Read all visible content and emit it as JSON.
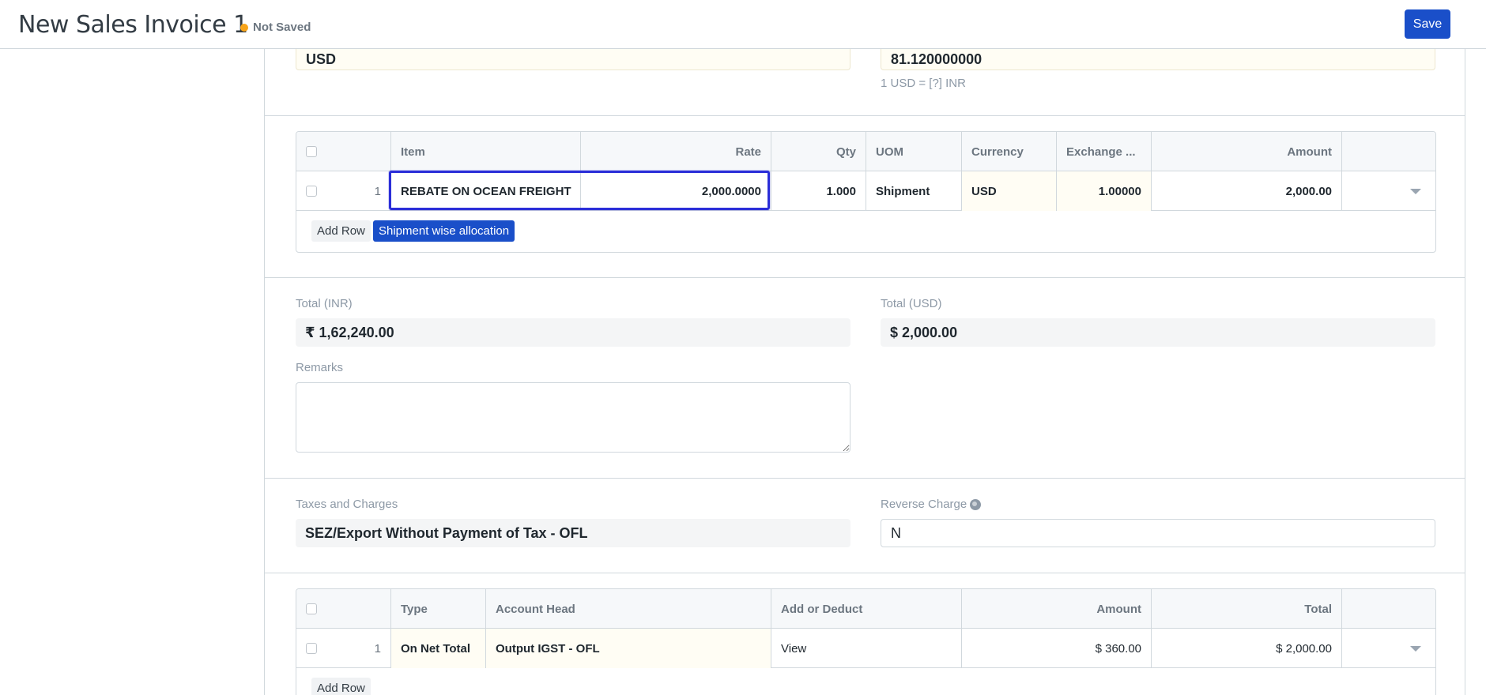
{
  "header": {
    "title": "New Sales Invoice 1",
    "status": "Not Saved",
    "save_label": "Save"
  },
  "currency_section": {
    "currency_value": "USD",
    "exchange_rate_value": "81.120000000",
    "exchange_rate_help": "1 USD = [?] INR"
  },
  "items_table": {
    "columns": [
      "Item",
      "Rate",
      "Qty",
      "UOM",
      "Currency",
      "Exchange ...",
      "Amount"
    ],
    "rows": [
      {
        "idx": "1",
        "item": "REBATE ON OCEAN FREIGHT",
        "rate": "2,000.0000",
        "qty": "1.000",
        "uom": "Shipment",
        "currency": "USD",
        "exchange": "1.00000",
        "amount": "2,000.00"
      }
    ],
    "add_row_label": "Add Row",
    "shipment_label": "Shipment wise allocation"
  },
  "totals": {
    "total_inr_label": "Total (INR)",
    "total_inr_value": "₹ 1,62,240.00",
    "total_usd_label": "Total (USD)",
    "total_usd_value": "$ 2,000.00",
    "remarks_label": "Remarks"
  },
  "taxes": {
    "taxes_label": "Taxes and Charges",
    "taxes_value": "SEZ/Export Without Payment of Tax - OFL",
    "reverse_label": "Reverse Charge",
    "reverse_value": "N"
  },
  "tax_table": {
    "columns": [
      "Type",
      "Account Head",
      "Add or Deduct",
      "Amount",
      "Total"
    ],
    "rows": [
      {
        "idx": "1",
        "type": "On Net Total",
        "account": "Output IGST - OFL",
        "add_deduct": "View",
        "amount": "$ 360.00",
        "total": "$ 2,000.00"
      }
    ],
    "add_row_label": "Add Row"
  },
  "colors": {
    "primary": "#1a4fc9",
    "highlight": "#2b2ed8",
    "not_saved_dot": "#f8a51a"
  }
}
